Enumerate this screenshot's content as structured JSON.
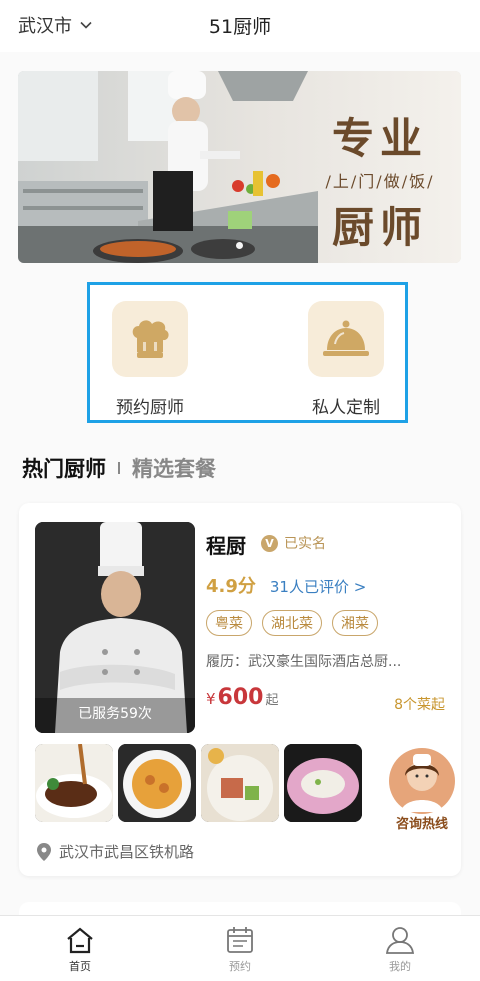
{
  "header": {
    "city": "武汉市",
    "title": "51厨师"
  },
  "banner": {
    "line1": "专业",
    "line2": "/上/门/做/饭/",
    "line3": "厨师"
  },
  "entries": [
    {
      "label": "预约厨师",
      "icon": "chef-hat-icon"
    },
    {
      "label": "私人定制",
      "icon": "cloche-icon"
    }
  ],
  "tabs": {
    "active": "热门厨师",
    "inactive": "精选套餐"
  },
  "chef_card": {
    "name": "程厨",
    "verified": "已实名",
    "served": "已服务59次",
    "score": "4.9分",
    "reviews": "31人已评价 >",
    "cuisines": [
      "粤菜",
      "湖北菜",
      "湘菜"
    ],
    "resume": "履历：武汉豪生国际酒店总厨...",
    "price_currency": "¥",
    "price_value": "600",
    "price_unit": "起",
    "min_dishes": "8个菜起",
    "hotline": "咨询热线",
    "address": "武汉市武昌区铁机路"
  },
  "bottom_nav": [
    {
      "label": "首页",
      "icon": "home-icon",
      "active": true
    },
    {
      "label": "预约",
      "icon": "calendar-icon",
      "active": false
    },
    {
      "label": "我的",
      "icon": "user-icon",
      "active": false
    }
  ],
  "colors": {
    "accent": "#c9a66b",
    "price": "#c8373b",
    "link": "#3a7fc1",
    "highlight_border": "#1ea1e6"
  }
}
